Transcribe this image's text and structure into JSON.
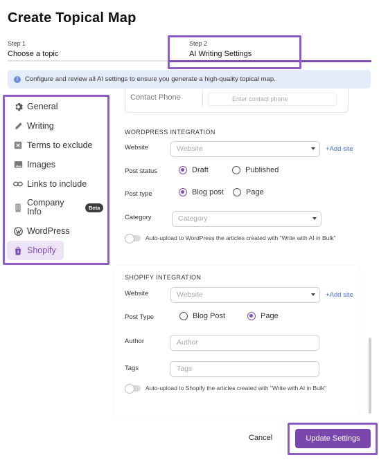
{
  "dialog": {
    "title": "Create Topical Map"
  },
  "steps": [
    {
      "number": "Step 1",
      "name": "Choose a topic"
    },
    {
      "number": "Step 2",
      "name": "AI Writing Settings"
    }
  ],
  "banner": {
    "text": "Configure and review all AI settings to ensure you generate a high-quality topical map."
  },
  "sidebar": {
    "items": [
      {
        "label": "General",
        "icon": "gear-icon"
      },
      {
        "label": "Writing",
        "icon": "pen-icon"
      },
      {
        "label": "Terms to exclude",
        "icon": "x-square-icon"
      },
      {
        "label": "Images",
        "icon": "image-icon"
      },
      {
        "label": "Links to include",
        "icon": "link-icon"
      },
      {
        "label": "Company Info",
        "icon": "building-icon",
        "badge": "Beta"
      },
      {
        "label": "WordPress",
        "icon": "wordpress-icon"
      },
      {
        "label": "Shopify",
        "icon": "shopify-icon",
        "active": true
      }
    ]
  },
  "contact": {
    "label": "Contact Phone",
    "placeholder": "Enter contact phone"
  },
  "wordpress": {
    "section_title": "WORDPRESS INTEGRATION",
    "website_label": "Website",
    "website_placeholder": "Website",
    "add_site": "+Add site",
    "post_status_label": "Post status",
    "post_status_options": [
      "Draft",
      "Published"
    ],
    "post_status_selected": "Draft",
    "post_type_label": "Post type",
    "post_type_options": [
      "Blog post",
      "Page"
    ],
    "post_type_selected": "Blog post",
    "category_label": "Category",
    "category_placeholder": "Category",
    "auto_upload_text": "Auto-upload to WordPress the articles created with \"Write with AI in Bulk\"",
    "auto_upload_enabled": false
  },
  "shopify": {
    "section_title": "SHOPIFY INTEGRATION",
    "website_label": "Website",
    "website_placeholder": "Website",
    "add_site": "+Add site",
    "post_type_label": "Post Type",
    "post_type_options": [
      "Blog Post",
      "Page"
    ],
    "post_type_selected": "Page",
    "author_label": "Author",
    "author_placeholder": "Author",
    "tags_label": "Tags",
    "tags_placeholder": "Tags",
    "auto_upload_text": "Auto-upload to Shopify the articles created with \"Write with AI in Bulk\"",
    "auto_upload_enabled": false
  },
  "footer": {
    "cancel": "Cancel",
    "update": "Update Settings"
  },
  "colors": {
    "accent": "#7a48ad",
    "highlight": "#8f5bc7",
    "banner_bg": "#e4ebfa",
    "link": "#4372c4"
  }
}
